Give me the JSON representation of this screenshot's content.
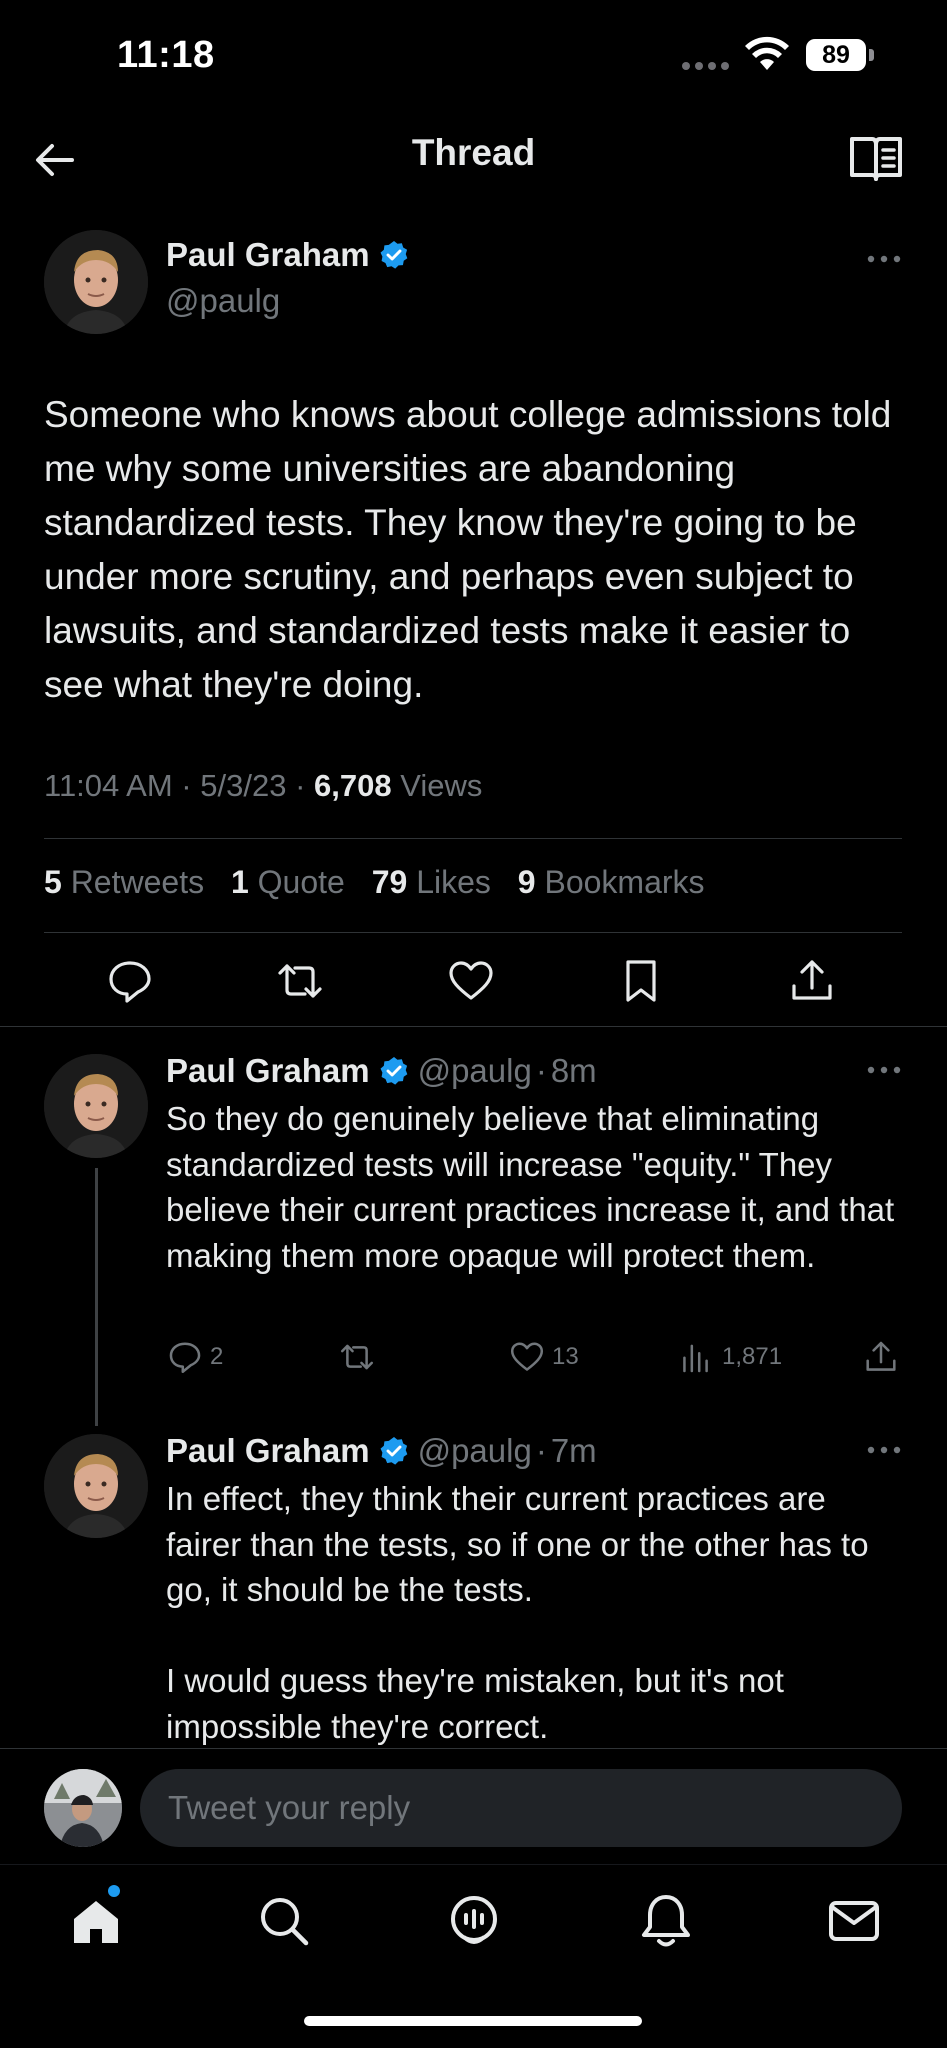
{
  "status_bar": {
    "time": "11:18",
    "battery": "89"
  },
  "header": {
    "title": "Thread"
  },
  "main_tweet": {
    "author": "Paul Graham",
    "handle": "@paulg",
    "text": "Someone who knows about college admissions told me why some universities are abandoning standardized tests. They know they're going to be under more scrutiny, and perhaps even subject to lawsuits, and standardized tests make it easier to see what they're doing.",
    "time": "11:04 AM",
    "date": "5/3/23",
    "views_count": "6,708",
    "views_label": "Views",
    "stats": {
      "retweets_count": "5",
      "retweets_label": "Retweets",
      "quotes_count": "1",
      "quotes_label": "Quote",
      "likes_count": "79",
      "likes_label": "Likes",
      "bookmarks_count": "9",
      "bookmarks_label": "Bookmarks"
    }
  },
  "replies": [
    {
      "author": "Paul Graham",
      "handle": "@paulg",
      "age": "8m",
      "text": "So they do genuinely believe that eliminating standardized tests will increase \"equity.\" They believe their current practices increase it, and that making them more opaque will protect them.",
      "reply_count": "2",
      "like_count": "13",
      "view_count": "1,871"
    },
    {
      "author": "Paul Graham",
      "handle": "@paulg",
      "age": "7m",
      "text_p1": "In effect, they think their current practices are fairer than the tests, so if one or the other has to go, it should be the tests.",
      "text_p2": "I would guess they're mistaken, but it's not impossible they're correct."
    }
  ],
  "composer": {
    "placeholder": "Tweet your reply"
  },
  "colors": {
    "accent": "#1d9bf0",
    "background": "#000000",
    "muted": "#71767b",
    "text": "#e7e9ea"
  },
  "icons": [
    "back-arrow-icon",
    "reader-mode-icon",
    "verified-badge-icon",
    "more-icon",
    "reply-icon",
    "retweet-icon",
    "like-icon",
    "bookmark-icon",
    "share-icon",
    "views-icon",
    "home-icon",
    "search-icon",
    "spaces-icon",
    "notifications-icon",
    "messages-icon"
  ]
}
